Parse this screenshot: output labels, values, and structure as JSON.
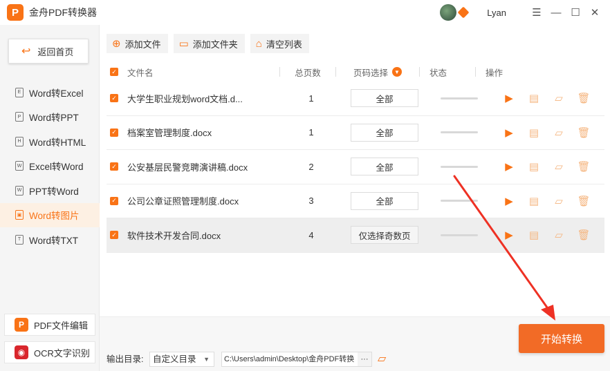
{
  "app": {
    "title": "金舟PDF转换器",
    "logo_letter": "P"
  },
  "user": {
    "name": "Lyan"
  },
  "window_controls": {
    "menu": "☰",
    "minimize": "—",
    "maximize": "☐",
    "close": "✕"
  },
  "sidebar": {
    "home_label": "返回首页",
    "items": [
      {
        "label": "Word转Excel",
        "icon": "E"
      },
      {
        "label": "Word转PPT",
        "icon": "P"
      },
      {
        "label": "Word转HTML",
        "icon": "H"
      },
      {
        "label": "Excel转Word",
        "icon": "W"
      },
      {
        "label": "PPT转Word",
        "icon": "W"
      },
      {
        "label": "Word转图片",
        "icon": "▣"
      },
      {
        "label": "Word转TXT",
        "icon": "T"
      }
    ],
    "bottom": [
      {
        "label": "PDF文件编辑",
        "icon": "P"
      },
      {
        "label": "OCR文字识别",
        "icon": "◉"
      }
    ]
  },
  "toolbar": {
    "add_file": "添加文件",
    "add_folder": "添加文件夹",
    "clear_list": "清空列表"
  },
  "table": {
    "headers": {
      "name": "文件名",
      "pages": "总页数",
      "range": "页码选择",
      "status": "状态",
      "ops": "操作"
    },
    "rows": [
      {
        "name": "大学生职业规划word文档.d...",
        "pages": "1",
        "range": "全部",
        "progress": 0
      },
      {
        "name": "档案室管理制度.docx",
        "pages": "1",
        "range": "全部",
        "progress": 0
      },
      {
        "name": "公安基层民警竞聘演讲稿.docx",
        "pages": "2",
        "range": "全部",
        "progress": 0
      },
      {
        "name": "公司公章证照管理制度.docx",
        "pages": "3",
        "range": "全部",
        "progress": 0
      },
      {
        "name": "软件技术开发合同.docx",
        "pages": "4",
        "range": "仅选择奇数页",
        "progress": 0
      }
    ]
  },
  "footer": {
    "output_label": "输出目录:",
    "output_mode": "自定义目录",
    "output_path": "C:\\Users\\admin\\Desktop\\金舟PDF转换",
    "more": "···",
    "start_label": "开始转换"
  },
  "colors": {
    "accent": "#f97316",
    "start": "#f26b26",
    "arrow": "#ee3124"
  }
}
